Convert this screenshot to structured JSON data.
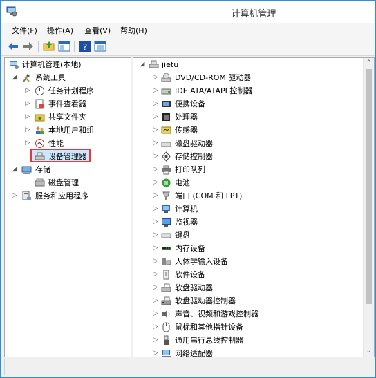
{
  "window": {
    "title": "计算机管理"
  },
  "menu": {
    "file": "文件(F)",
    "action": "操作(A)",
    "view": "查看(V)",
    "help": "帮助(H)"
  },
  "left_tree": {
    "root": "计算机管理(本地)",
    "system_tools": "系统工具",
    "task_scheduler": "任务计划程序",
    "event_viewer": "事件查看器",
    "shared_folders": "共享文件夹",
    "local_users": "本地用户和组",
    "performance": "性能",
    "device_manager": "设备管理器",
    "storage": "存储",
    "disk_management": "磁盘管理",
    "services_apps": "服务和应用程序"
  },
  "right_tree": {
    "root": "jietu",
    "items": [
      "DVD/CD-ROM 驱动器",
      "IDE ATA/ATAPI 控制器",
      "便携设备",
      "处理器",
      "传感器",
      "磁盘驱动器",
      "存储控制器",
      "打印队列",
      "电池",
      "端口 (COM 和 LPT)",
      "计算机",
      "监视器",
      "键盘",
      "内存设备",
      "人体学输入设备",
      "软件设备",
      "软盘驱动器",
      "软盘驱动器控制器",
      "声音、视频和游戏控制器",
      "鼠标和其他指针设备",
      "通用串行总线控制器",
      "网络适配器"
    ]
  }
}
